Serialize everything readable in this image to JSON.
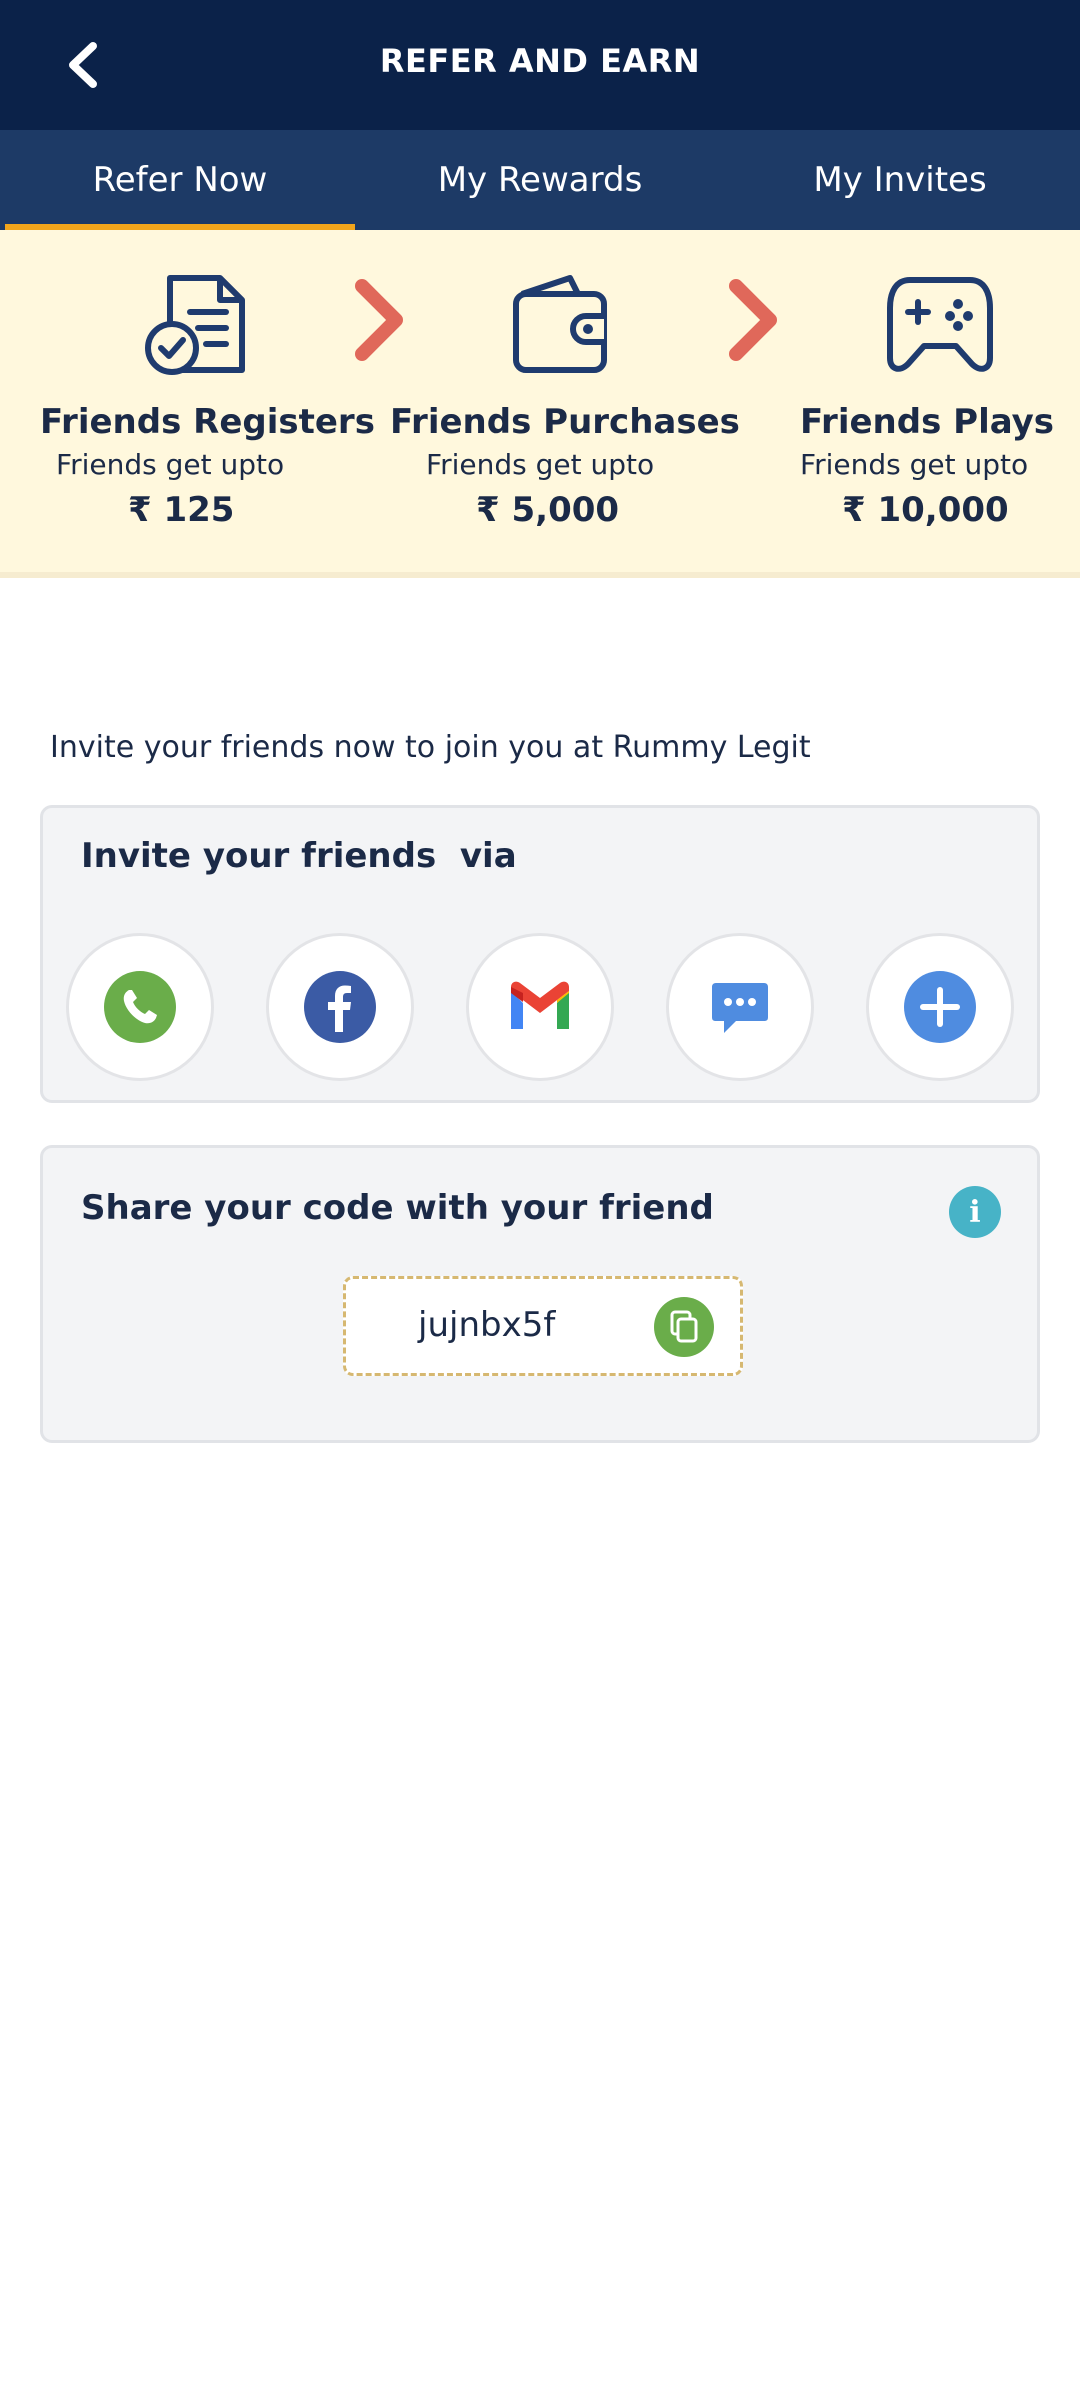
{
  "header": {
    "title": "REFER AND EARN",
    "back_icon": "chevron-left-icon"
  },
  "tabs": [
    {
      "label": "Refer Now",
      "active": true
    },
    {
      "label": "My Rewards",
      "active": false
    },
    {
      "label": "My Invites",
      "active": false
    }
  ],
  "steps": [
    {
      "icon": "document-check-icon",
      "title": "Friends Registers",
      "subtitle": "Friends get upto",
      "amount": "₹ 125"
    },
    {
      "icon": "wallet-icon",
      "title": "Friends Purchases",
      "subtitle": "Friends get upto",
      "amount": "₹ 5,000"
    },
    {
      "icon": "gamepad-icon",
      "title": "Friends Plays",
      "subtitle": "Friends get upto",
      "amount": "₹ 10,000"
    }
  ],
  "invite_text": "Invite your friends now to join you at Rummy Legit",
  "invite_card": {
    "title": "Invite your friends  via",
    "options": [
      "whatsapp-icon",
      "facebook-icon",
      "gmail-icon",
      "sms-icon",
      "more-icon"
    ]
  },
  "code_card": {
    "title": "Share your code with your friend",
    "code": "jujnbx5f",
    "info_icon": "info-icon",
    "copy_icon": "copy-icon"
  },
  "colors": {
    "header_bg": "#0b2249",
    "tabs_bg": "#1d3a66",
    "tab_indicator": "#f2a51c",
    "steps_bg": "#fff8dd",
    "arrow": "#e0685a",
    "card_bg": "#f3f4f6",
    "whatsapp": "#6aad4a",
    "facebook": "#3b5ba5",
    "info": "#47b3c7"
  }
}
